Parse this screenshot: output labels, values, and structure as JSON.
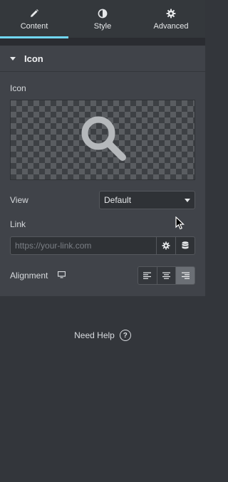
{
  "tabs": [
    {
      "label": "Content",
      "icon": "pencil-icon",
      "active": true
    },
    {
      "label": "Style",
      "icon": "contrast-icon",
      "active": false
    },
    {
      "label": "Advanced",
      "icon": "gear-icon",
      "active": false
    }
  ],
  "section": {
    "title": "Icon",
    "icon_label": "Icon",
    "icon_preview": "search-icon",
    "view_label": "View",
    "view_value": "Default",
    "link_label": "Link",
    "link_placeholder": "https://your-link.com",
    "alignment_label": "Alignment",
    "alignment_device_icon": "desktop-icon",
    "alignment_options": [
      "left",
      "center",
      "right"
    ],
    "alignment_selected": "right"
  },
  "help": {
    "label": "Need Help"
  },
  "colors": {
    "accent": "#71d7f7",
    "panel": "#404349",
    "background": "#33363b"
  }
}
